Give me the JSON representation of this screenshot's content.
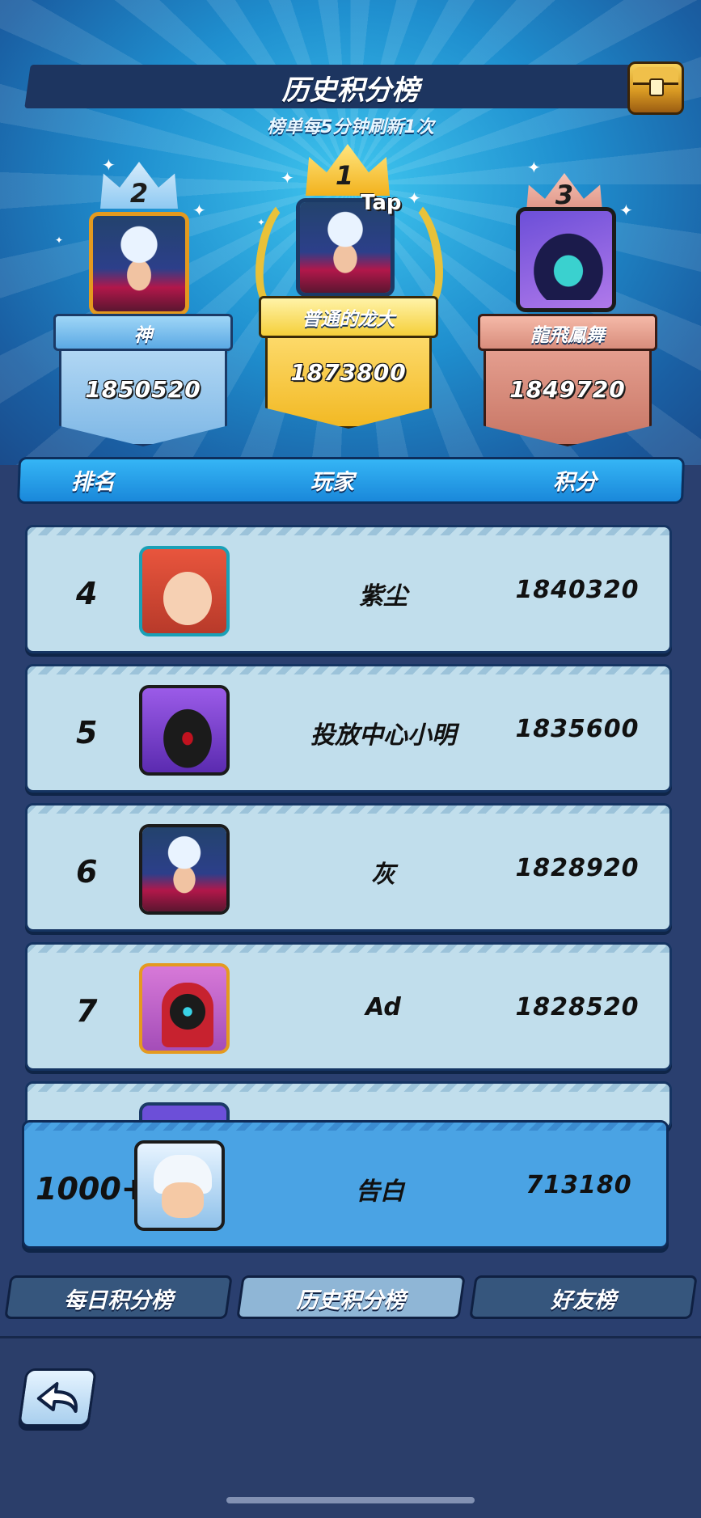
{
  "header": {
    "title": "历史积分榜",
    "subtitle": "榜单每5分钟刷新1次"
  },
  "podium": {
    "first": {
      "rank": "1",
      "name": "普通的龙大",
      "score": "1873800",
      "tap_label": "Tap"
    },
    "second": {
      "rank": "2",
      "name": "神",
      "score": "1850520"
    },
    "third": {
      "rank": "3",
      "name": "龍飛鳳舞",
      "score": "1849720"
    }
  },
  "columns": {
    "rank": "排名",
    "player": "玩家",
    "score": "积分"
  },
  "rows": [
    {
      "rank": "4",
      "name": "紫尘",
      "score": "1840320"
    },
    {
      "rank": "5",
      "name": "投放中心小明",
      "score": "1835600"
    },
    {
      "rank": "6",
      "name": "灰",
      "score": "1828920"
    },
    {
      "rank": "7",
      "name": "Ad",
      "score": "1828520"
    }
  ],
  "self_row": {
    "rank": "1000+",
    "name": "告白",
    "score": "713180"
  },
  "tabs": [
    {
      "label": "每日积分榜",
      "active": false
    },
    {
      "label": "历史积分榜",
      "active": true
    },
    {
      "label": "好友榜",
      "active": false
    }
  ],
  "colors": {
    "gold": "#f2c331",
    "silver": "#8ec9f2",
    "bronze": "#d9887a",
    "row_bg": "#c1deec",
    "self_row_bg": "#4aa3e4"
  },
  "icons": {
    "back": "back-arrow-icon",
    "chest": "treasure-chest-icon"
  }
}
